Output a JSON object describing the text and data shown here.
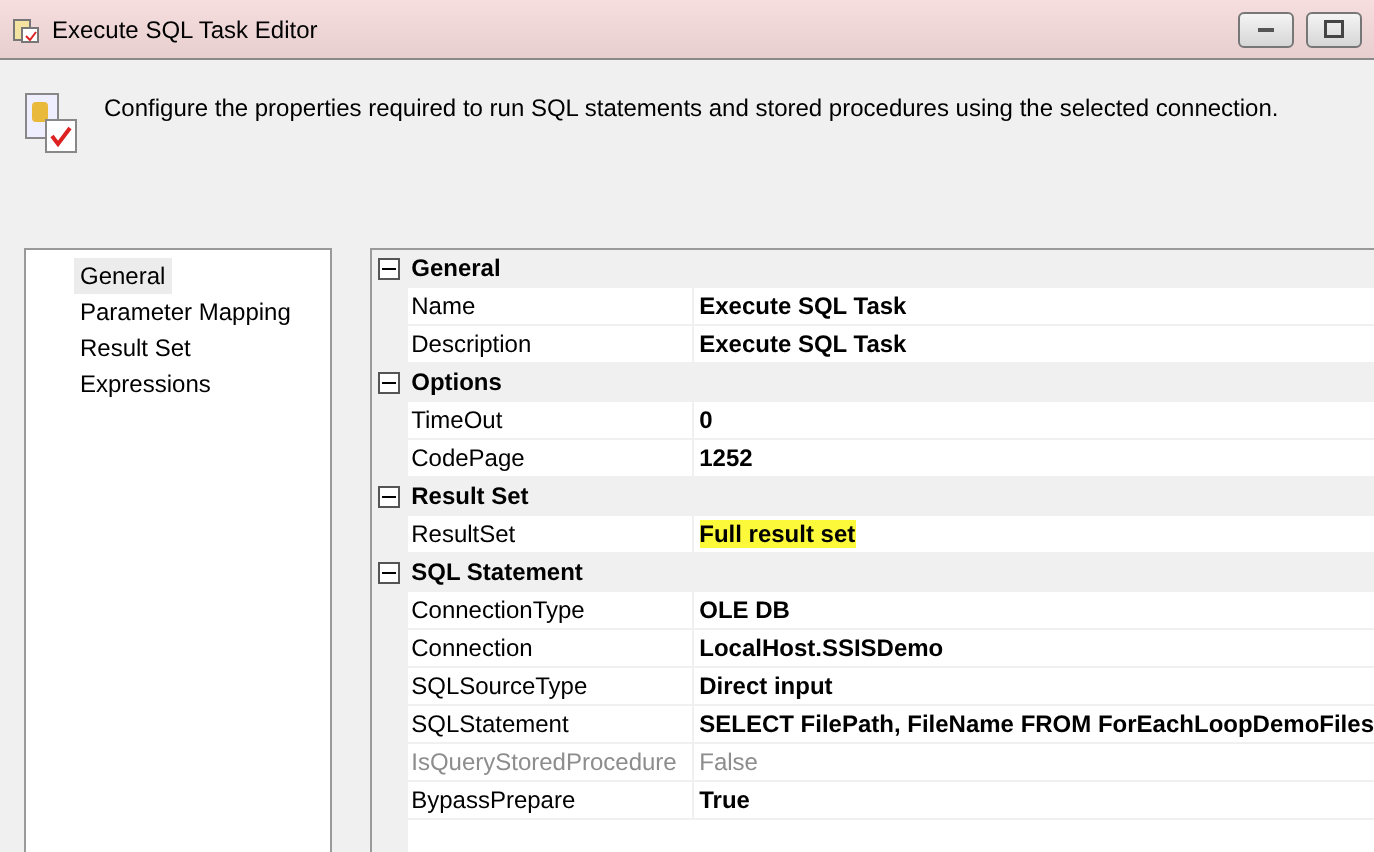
{
  "window": {
    "title": "Execute SQL Task Editor"
  },
  "header": {
    "description": "Configure the properties required to run SQL statements and stored procedures using the selected connection."
  },
  "sidebar": {
    "items": [
      {
        "label": "General",
        "selected": true
      },
      {
        "label": "Parameter Mapping",
        "selected": false
      },
      {
        "label": "Result Set",
        "selected": false
      },
      {
        "label": "Expressions",
        "selected": false
      }
    ]
  },
  "property_grid": {
    "groups": [
      {
        "name": "General",
        "expanded": true,
        "properties": [
          {
            "name": "Name",
            "value": "Execute SQL Task",
            "disabled": false,
            "highlighted": false
          },
          {
            "name": "Description",
            "value": "Execute SQL Task",
            "disabled": false,
            "highlighted": false
          }
        ]
      },
      {
        "name": "Options",
        "expanded": true,
        "properties": [
          {
            "name": "TimeOut",
            "value": "0",
            "disabled": false,
            "highlighted": false
          },
          {
            "name": "CodePage",
            "value": "1252",
            "disabled": false,
            "highlighted": false
          }
        ]
      },
      {
        "name": "Result Set",
        "expanded": true,
        "properties": [
          {
            "name": "ResultSet",
            "value": "Full result set",
            "disabled": false,
            "highlighted": true
          }
        ]
      },
      {
        "name": "SQL Statement",
        "expanded": true,
        "properties": [
          {
            "name": "ConnectionType",
            "value": "OLE DB",
            "disabled": false,
            "highlighted": false
          },
          {
            "name": "Connection",
            "value": "LocalHost.SSISDemo",
            "disabled": false,
            "highlighted": false
          },
          {
            "name": "SQLSourceType",
            "value": "Direct input",
            "disabled": false,
            "highlighted": false
          },
          {
            "name": "SQLStatement",
            "value": "SELECT FilePath, FileName FROM ForEachLoopDemoFiles",
            "disabled": false,
            "highlighted": false
          },
          {
            "name": "IsQueryStoredProcedure",
            "value": "False",
            "disabled": true,
            "highlighted": false
          },
          {
            "name": "BypassPrepare",
            "value": "True",
            "disabled": false,
            "highlighted": false
          }
        ]
      }
    ]
  }
}
